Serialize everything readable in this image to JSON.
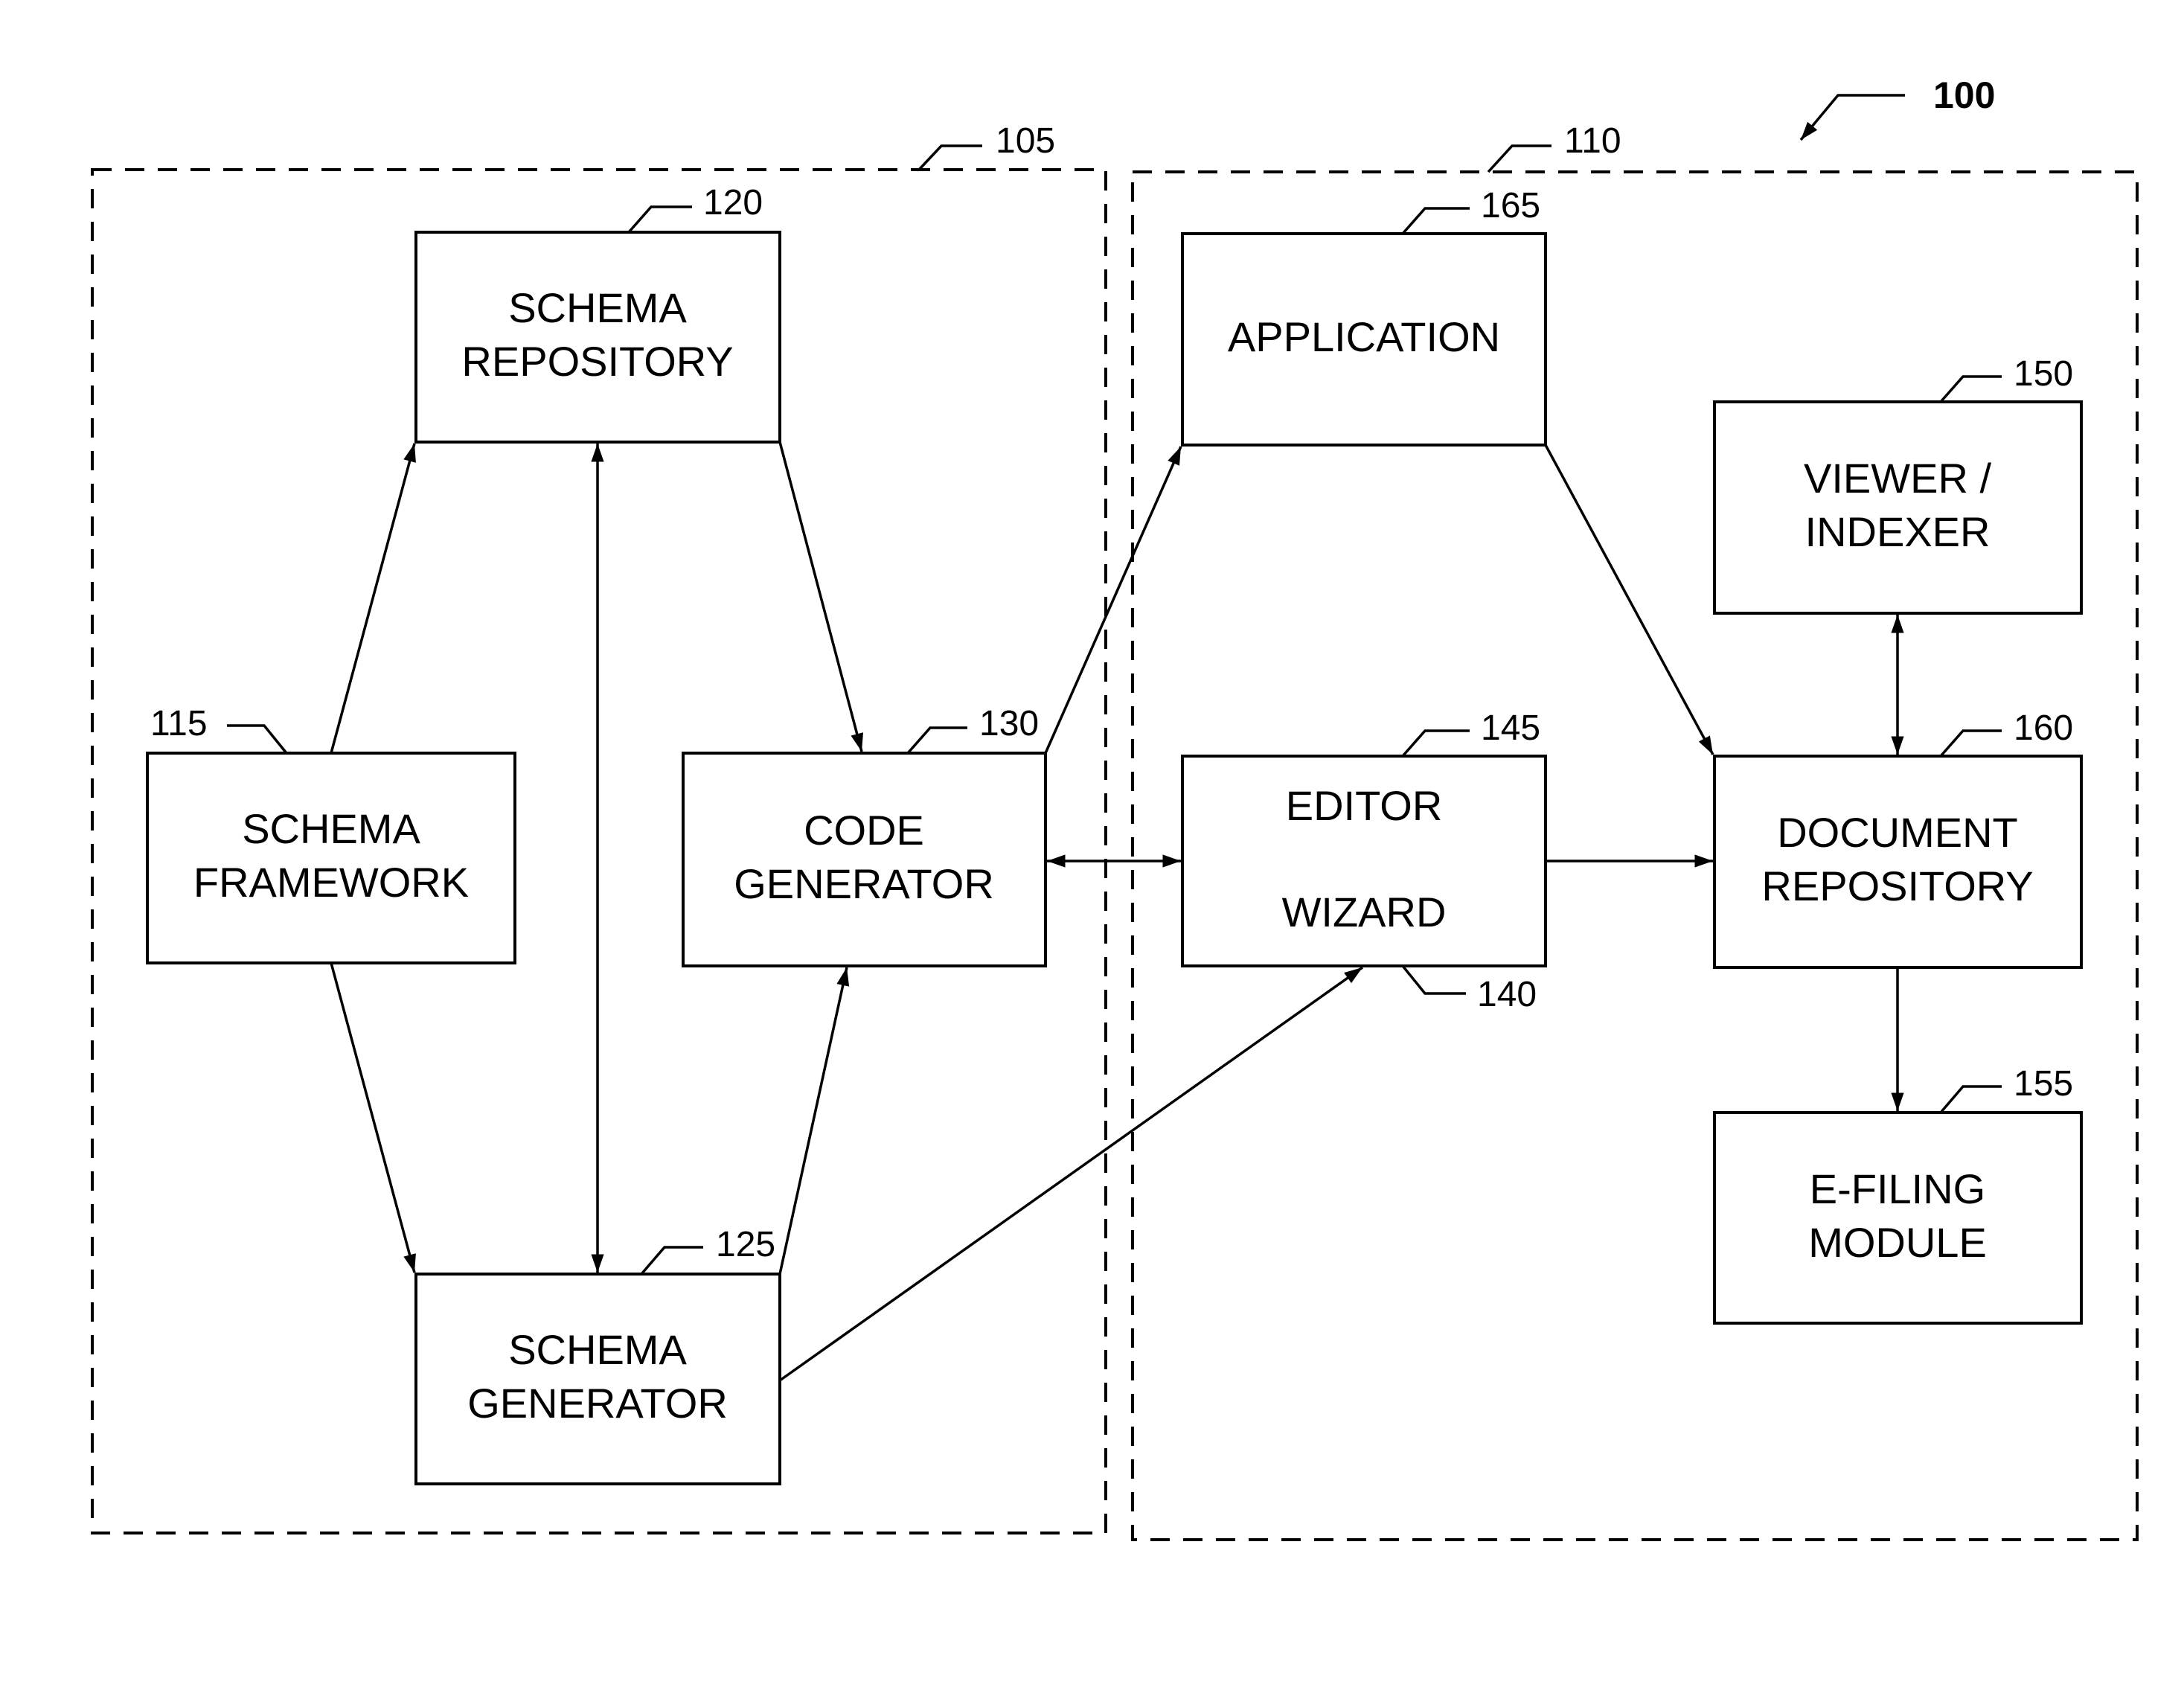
{
  "figure": {
    "ref": "100",
    "groups": [
      {
        "id": "g105",
        "ref": "105"
      },
      {
        "id": "g110",
        "ref": "110"
      }
    ],
    "blocks": {
      "b115": {
        "ref": "115",
        "lines": [
          "SCHEMA",
          "FRAMEWORK"
        ]
      },
      "b120": {
        "ref": "120",
        "lines": [
          "SCHEMA",
          "REPOSITORY"
        ]
      },
      "b125": {
        "ref": "125",
        "lines": [
          "SCHEMA",
          "GENERATOR"
        ]
      },
      "b130": {
        "ref": "130",
        "lines": [
          "CODE",
          "GENERATOR"
        ]
      },
      "b165": {
        "ref": "165",
        "lines": [
          "APPLICATION"
        ]
      },
      "b145": {
        "ref": "145",
        "lines": [
          "EDITOR"
        ]
      },
      "b140": {
        "ref": "140",
        "lines": [
          "WIZARD"
        ]
      },
      "b150": {
        "ref": "150",
        "lines": [
          "VIEWER /",
          "INDEXER"
        ]
      },
      "b160": {
        "ref": "160",
        "lines": [
          "DOCUMENT",
          "REPOSITORY"
        ]
      },
      "b155": {
        "ref": "155",
        "lines": [
          "E-FILING",
          "MODULE"
        ]
      }
    },
    "connections": [
      {
        "from": "115",
        "to": "120",
        "type": "arrow"
      },
      {
        "from": "115",
        "to": "125",
        "type": "arrow"
      },
      {
        "from": "120",
        "to": "125",
        "type": "bidirectional"
      },
      {
        "from": "120",
        "to": "130",
        "type": "arrow"
      },
      {
        "from": "125",
        "to": "130",
        "type": "arrow"
      },
      {
        "from": "130",
        "to": "165",
        "type": "arrow"
      },
      {
        "from": "130",
        "to": "145/140",
        "type": "bidirectional"
      },
      {
        "from": "145/140",
        "to": "160",
        "type": "arrow"
      },
      {
        "from": "125",
        "to": "140",
        "type": "arrow"
      },
      {
        "from": "165",
        "to": "160",
        "type": "arrow"
      },
      {
        "from": "150",
        "to": "160",
        "type": "bidirectional"
      },
      {
        "from": "160",
        "to": "155",
        "type": "arrow"
      }
    ]
  }
}
